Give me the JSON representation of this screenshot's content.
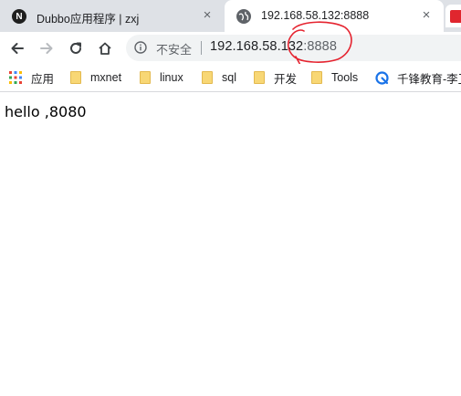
{
  "tabs": [
    {
      "title": "Dubbo应用程序 | zxj",
      "favicon": "dubbo-logo-icon",
      "close": "×",
      "active": false
    },
    {
      "title": "192.168.58.132:8888",
      "favicon": "globe-icon",
      "close": "×",
      "active": true
    }
  ],
  "toolbar": {
    "back": "back-arrow-icon",
    "forward": "forward-arrow-icon",
    "reload": "reload-icon",
    "home": "home-icon"
  },
  "omnibox": {
    "security_label": "不安全",
    "url_host": "192.168.58.132",
    "url_port": ":8888"
  },
  "bookmarks": [
    {
      "label": "应用",
      "icon": "apps-grid-icon"
    },
    {
      "label": "mxnet",
      "icon": "folder-icon"
    },
    {
      "label": "linux",
      "icon": "folder-icon"
    },
    {
      "label": "sql",
      "icon": "folder-icon"
    },
    {
      "label": "开发",
      "icon": "folder-icon"
    },
    {
      "label": "Tools",
      "icon": "folder-icon"
    },
    {
      "label": "千锋教育-李卫",
      "icon": "qianfeng-logo-icon"
    }
  ],
  "page": {
    "body_text": "hello ,8080"
  },
  "colors": {
    "tabbar_bg": "#dee1e6",
    "omnibox_bg": "#f1f3f4",
    "annotation_red": "#e5232f"
  }
}
